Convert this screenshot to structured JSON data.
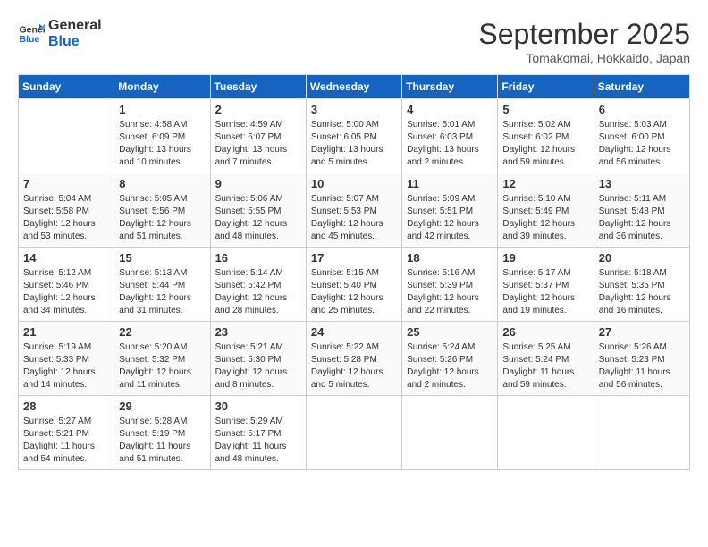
{
  "header": {
    "logo_line1": "General",
    "logo_line2": "Blue",
    "month_title": "September 2025",
    "subtitle": "Tomakomai, Hokkaido, Japan"
  },
  "columns": [
    "Sunday",
    "Monday",
    "Tuesday",
    "Wednesday",
    "Thursday",
    "Friday",
    "Saturday"
  ],
  "weeks": [
    [
      {
        "day": "",
        "info": ""
      },
      {
        "day": "1",
        "info": "Sunrise: 4:58 AM\nSunset: 6:09 PM\nDaylight: 13 hours\nand 10 minutes."
      },
      {
        "day": "2",
        "info": "Sunrise: 4:59 AM\nSunset: 6:07 PM\nDaylight: 13 hours\nand 7 minutes."
      },
      {
        "day": "3",
        "info": "Sunrise: 5:00 AM\nSunset: 6:05 PM\nDaylight: 13 hours\nand 5 minutes."
      },
      {
        "day": "4",
        "info": "Sunrise: 5:01 AM\nSunset: 6:03 PM\nDaylight: 13 hours\nand 2 minutes."
      },
      {
        "day": "5",
        "info": "Sunrise: 5:02 AM\nSunset: 6:02 PM\nDaylight: 12 hours\nand 59 minutes."
      },
      {
        "day": "6",
        "info": "Sunrise: 5:03 AM\nSunset: 6:00 PM\nDaylight: 12 hours\nand 56 minutes."
      }
    ],
    [
      {
        "day": "7",
        "info": "Sunrise: 5:04 AM\nSunset: 5:58 PM\nDaylight: 12 hours\nand 53 minutes."
      },
      {
        "day": "8",
        "info": "Sunrise: 5:05 AM\nSunset: 5:56 PM\nDaylight: 12 hours\nand 51 minutes."
      },
      {
        "day": "9",
        "info": "Sunrise: 5:06 AM\nSunset: 5:55 PM\nDaylight: 12 hours\nand 48 minutes."
      },
      {
        "day": "10",
        "info": "Sunrise: 5:07 AM\nSunset: 5:53 PM\nDaylight: 12 hours\nand 45 minutes."
      },
      {
        "day": "11",
        "info": "Sunrise: 5:09 AM\nSunset: 5:51 PM\nDaylight: 12 hours\nand 42 minutes."
      },
      {
        "day": "12",
        "info": "Sunrise: 5:10 AM\nSunset: 5:49 PM\nDaylight: 12 hours\nand 39 minutes."
      },
      {
        "day": "13",
        "info": "Sunrise: 5:11 AM\nSunset: 5:48 PM\nDaylight: 12 hours\nand 36 minutes."
      }
    ],
    [
      {
        "day": "14",
        "info": "Sunrise: 5:12 AM\nSunset: 5:46 PM\nDaylight: 12 hours\nand 34 minutes."
      },
      {
        "day": "15",
        "info": "Sunrise: 5:13 AM\nSunset: 5:44 PM\nDaylight: 12 hours\nand 31 minutes."
      },
      {
        "day": "16",
        "info": "Sunrise: 5:14 AM\nSunset: 5:42 PM\nDaylight: 12 hours\nand 28 minutes."
      },
      {
        "day": "17",
        "info": "Sunrise: 5:15 AM\nSunset: 5:40 PM\nDaylight: 12 hours\nand 25 minutes."
      },
      {
        "day": "18",
        "info": "Sunrise: 5:16 AM\nSunset: 5:39 PM\nDaylight: 12 hours\nand 22 minutes."
      },
      {
        "day": "19",
        "info": "Sunrise: 5:17 AM\nSunset: 5:37 PM\nDaylight: 12 hours\nand 19 minutes."
      },
      {
        "day": "20",
        "info": "Sunrise: 5:18 AM\nSunset: 5:35 PM\nDaylight: 12 hours\nand 16 minutes."
      }
    ],
    [
      {
        "day": "21",
        "info": "Sunrise: 5:19 AM\nSunset: 5:33 PM\nDaylight: 12 hours\nand 14 minutes."
      },
      {
        "day": "22",
        "info": "Sunrise: 5:20 AM\nSunset: 5:32 PM\nDaylight: 12 hours\nand 11 minutes."
      },
      {
        "day": "23",
        "info": "Sunrise: 5:21 AM\nSunset: 5:30 PM\nDaylight: 12 hours\nand 8 minutes."
      },
      {
        "day": "24",
        "info": "Sunrise: 5:22 AM\nSunset: 5:28 PM\nDaylight: 12 hours\nand 5 minutes."
      },
      {
        "day": "25",
        "info": "Sunrise: 5:24 AM\nSunset: 5:26 PM\nDaylight: 12 hours\nand 2 minutes."
      },
      {
        "day": "26",
        "info": "Sunrise: 5:25 AM\nSunset: 5:24 PM\nDaylight: 11 hours\nand 59 minutes."
      },
      {
        "day": "27",
        "info": "Sunrise: 5:26 AM\nSunset: 5:23 PM\nDaylight: 11 hours\nand 56 minutes."
      }
    ],
    [
      {
        "day": "28",
        "info": "Sunrise: 5:27 AM\nSunset: 5:21 PM\nDaylight: 11 hours\nand 54 minutes."
      },
      {
        "day": "29",
        "info": "Sunrise: 5:28 AM\nSunset: 5:19 PM\nDaylight: 11 hours\nand 51 minutes."
      },
      {
        "day": "30",
        "info": "Sunrise: 5:29 AM\nSunset: 5:17 PM\nDaylight: 11 hours\nand 48 minutes."
      },
      {
        "day": "",
        "info": ""
      },
      {
        "day": "",
        "info": ""
      },
      {
        "day": "",
        "info": ""
      },
      {
        "day": "",
        "info": ""
      }
    ]
  ]
}
